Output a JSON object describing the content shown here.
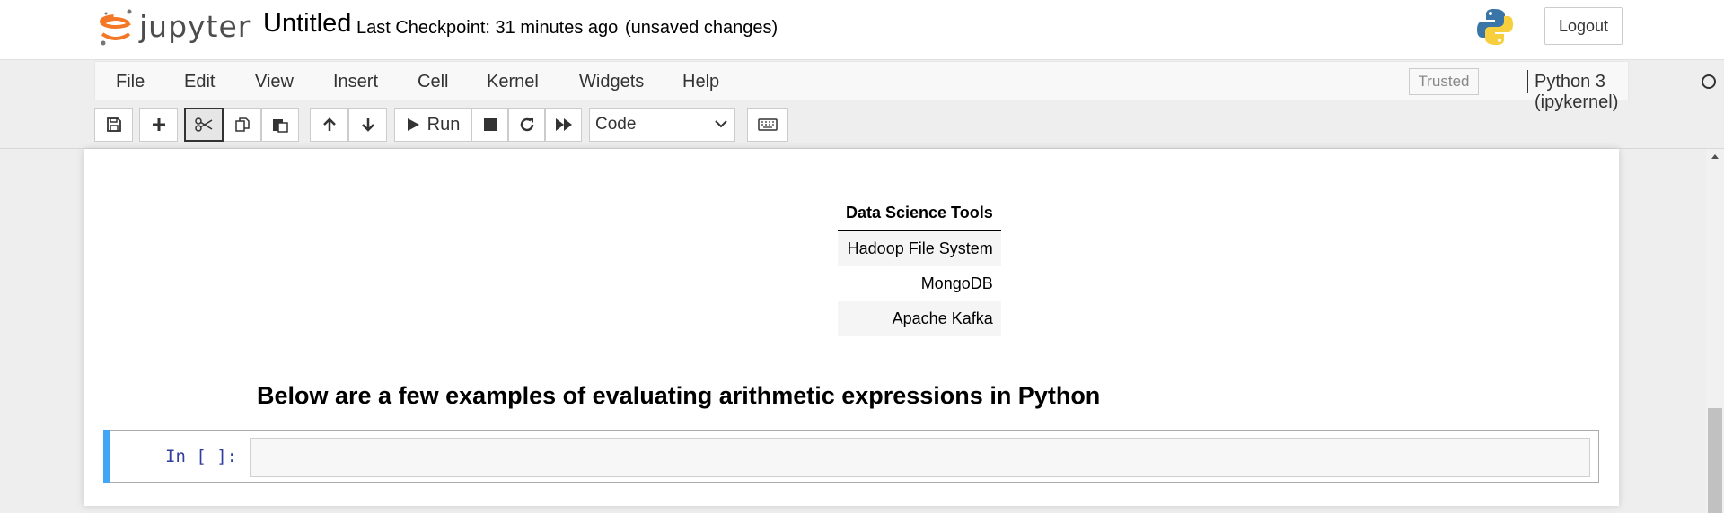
{
  "header": {
    "logo_text": "jupyter",
    "notebook_title": "Untitled",
    "checkpoint": "Last Checkpoint: 31 minutes ago",
    "autosave_status": "(unsaved changes)",
    "logout_label": "Logout"
  },
  "menubar": {
    "items": [
      "File",
      "Edit",
      "View",
      "Insert",
      "Cell",
      "Kernel",
      "Widgets",
      "Help"
    ],
    "trusted_label": "Trusted",
    "kernel_name": "Python 3 (ipykernel)"
  },
  "toolbar": {
    "run_label": "Run",
    "cell_type": "Code",
    "icons": [
      "save-icon",
      "plus-icon",
      "cut-icon",
      "copy-icon",
      "paste-icon",
      "arrow-up-icon",
      "arrow-down-icon",
      "play-icon",
      "stop-icon",
      "restart-icon",
      "fast-forward-icon",
      "keyboard-icon"
    ]
  },
  "output": {
    "table": {
      "header": "Data Science Tools",
      "rows": [
        "Hadoop File System",
        "MongoDB",
        "Apache Kafka"
      ]
    },
    "heading": "Below are a few examples of evaluating arithmetic expressions in Python"
  },
  "code_cell": {
    "prompt": "In [ ]:",
    "value": ""
  },
  "colors": {
    "accent": "#42a5f5",
    "prompt": "#303f9f",
    "jupyter_orange": "#f37726"
  }
}
